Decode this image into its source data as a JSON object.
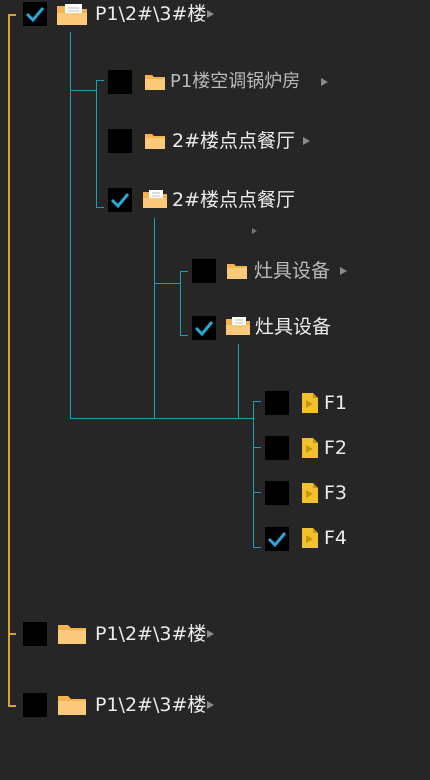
{
  "colors": {
    "background": "#262626",
    "guide_root": "#d9a23a",
    "guide_child": "#1b9db8",
    "checkbox": "#000000",
    "check_mark": "#29a8d8",
    "folder": "#fbc97a",
    "file": "#f2c12e"
  },
  "tree": {
    "root_top": {
      "label": "P1\\2#\\3#楼",
      "checked": true,
      "icon": "folder-open-icon"
    },
    "level1": [
      {
        "label": "P1楼空调锅炉房",
        "checked": false,
        "icon": "folder-icon"
      },
      {
        "label": "2#楼点点餐厅",
        "checked": false,
        "icon": "folder-icon"
      },
      {
        "label": "2#楼点点餐厅",
        "checked": true,
        "icon": "folder-open-icon"
      }
    ],
    "level2": [
      {
        "label": "灶具设备",
        "checked": false,
        "icon": "folder-icon"
      },
      {
        "label": "灶具设备",
        "checked": true,
        "icon": "folder-open-icon"
      }
    ],
    "level3": [
      {
        "label": "F1",
        "checked": false,
        "icon": "file-icon"
      },
      {
        "label": "F2",
        "checked": false,
        "icon": "file-icon"
      },
      {
        "label": "F3",
        "checked": false,
        "icon": "file-icon"
      },
      {
        "label": "F4",
        "checked": true,
        "icon": "file-icon"
      }
    ],
    "root_bottom": [
      {
        "label": "P1\\2#\\3#楼",
        "checked": false,
        "icon": "folder-icon"
      },
      {
        "label": "P1\\2#\\3#楼",
        "checked": false,
        "icon": "folder-icon"
      }
    ]
  }
}
